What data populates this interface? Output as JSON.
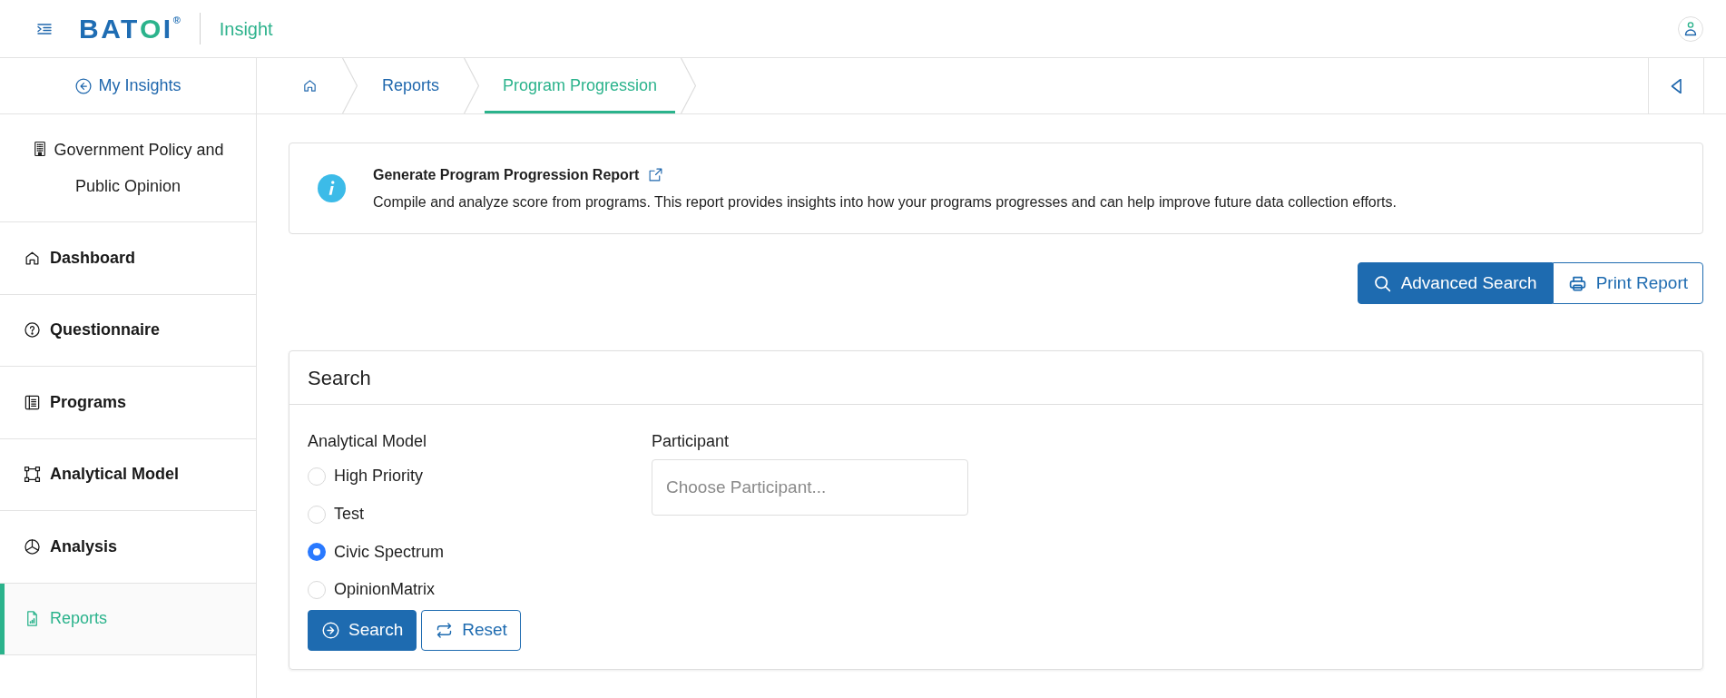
{
  "header": {
    "logo": {
      "parts": [
        "BAT",
        "O",
        "I"
      ],
      "mark": "®"
    },
    "app_name": "Insight"
  },
  "sidebar": {
    "back_link": "My Insights",
    "organization": "Government Policy and Public Opinion",
    "items": [
      {
        "label": "Dashboard",
        "selected": false
      },
      {
        "label": "Questionnaire",
        "selected": false
      },
      {
        "label": "Programs",
        "selected": false
      },
      {
        "label": "Analytical Model",
        "selected": false
      },
      {
        "label": "Analysis",
        "selected": false
      },
      {
        "label": "Reports",
        "selected": true
      }
    ]
  },
  "breadcrumb": [
    {
      "kind": "home",
      "selected": false
    },
    {
      "kind": "link",
      "label": "Reports",
      "selected": false
    },
    {
      "kind": "link",
      "label": "Program Progression",
      "selected": true
    }
  ],
  "info": {
    "title": "Generate Program Progression Report",
    "description": "Compile and analyze score from programs. This report provides insights into how your programs progresses and can help improve future data collection efforts."
  },
  "actions": [
    {
      "label": "Advanced Search",
      "kind": "primary"
    },
    {
      "label": "Print Report",
      "kind": "outline"
    }
  ],
  "search_panel": {
    "title": "Search",
    "model_label": "Analytical Model",
    "models": [
      {
        "label": "High Priority",
        "selected": false
      },
      {
        "label": "Test",
        "selected": false
      },
      {
        "label": "Civic Spectrum",
        "selected": true
      },
      {
        "label": "OpinionMatrix",
        "selected": false
      }
    ],
    "participant_label": "Participant",
    "participant": {
      "placeholder": "Choose Participant..."
    },
    "buttons": [
      {
        "label": "Search",
        "kind": "primary"
      },
      {
        "label": "Reset",
        "kind": "outline"
      }
    ]
  }
}
